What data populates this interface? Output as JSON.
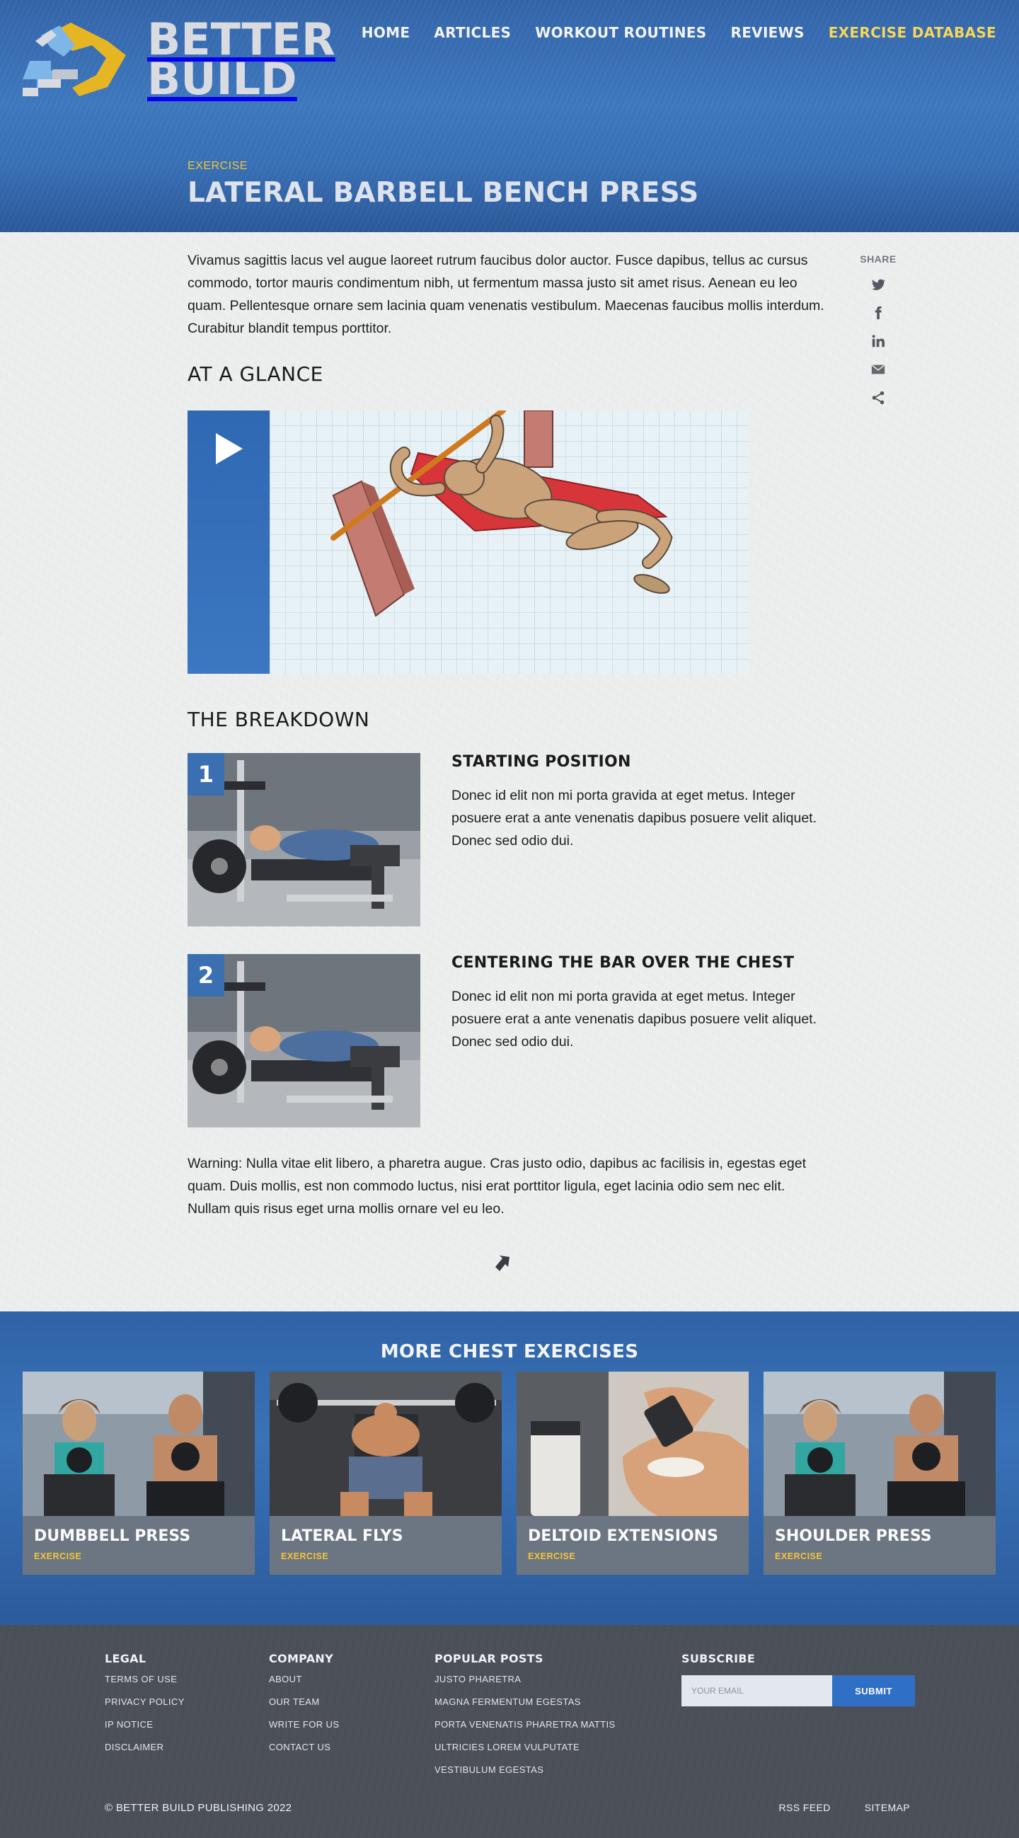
{
  "brand": {
    "name_line1": "BETTER",
    "name_line2": "BUILD",
    "colors": {
      "blue": "#3a72b8",
      "yellow": "#f2c43b",
      "light_blue": "#8fc1ec"
    }
  },
  "nav": {
    "items": [
      "HOME",
      "ARTICLES",
      "WORKOUT ROUTINES",
      "REVIEWS",
      "EXERCISE DATABASE"
    ],
    "active": "EXERCISE DATABASE"
  },
  "hero": {
    "kicker": "EXERCISE",
    "title": "LATERAL BARBELL BENCH PRESS"
  },
  "intro": "Vivamus sagittis lacus vel augue laoreet rutrum faucibus dolor auctor. Fusce dapibus, tellus ac cursus commodo, tortor mauris condimentum nibh, ut fermentum massa justo sit amet risus. Aenean eu leo quam. Pellentesque ornare sem lacinia quam venenatis vestibulum. Maecenas faucibus mollis interdum. Curabitur blandit tempus porttitor.",
  "share": {
    "label": "SHARE",
    "icons": [
      "twitter-icon",
      "facebook-icon",
      "linkedin-icon",
      "email-icon",
      "share-icon"
    ]
  },
  "sections": {
    "glance": "AT A GLANCE",
    "breakdown": "THE BREAKDOWN"
  },
  "steps": [
    {
      "num": "1",
      "title": "STARTING POSITION",
      "text": "Donec id elit non mi porta gravida at eget metus. Integer posuere erat a ante venenatis dapibus posuere velit aliquet. Donec sed odio dui."
    },
    {
      "num": "2",
      "title": "CENTERING THE BAR OVER THE CHEST",
      "text": "Donec id elit non mi porta gravida at eget metus. Integer posuere erat a ante venenatis dapibus posuere velit aliquet. Donec sed odio dui."
    }
  ],
  "warning": "Warning: Nulla vitae elit libero, a pharetra augue. Cras justo odio, dapibus ac facilisis in, egestas eget quam. Duis mollis, est non commodo luctus, nisi erat porttitor ligula, eget lacinia odio sem nec elit. Nullam quis risus eget urna mollis ornare vel eu leo.",
  "more": {
    "title": "MORE CHEST EXERCISES",
    "cards": [
      {
        "title": "DUMBBELL PRESS",
        "tag": "EXERCISE"
      },
      {
        "title": "LATERAL FLYS",
        "tag": "EXERCISE"
      },
      {
        "title": "DELTOID EXTENSIONS",
        "tag": "EXERCISE"
      },
      {
        "title": "SHOULDER PRESS",
        "tag": "EXERCISE"
      }
    ]
  },
  "footer": {
    "legal": {
      "heading": "LEGAL",
      "links": [
        "TERMS OF USE",
        "PRIVACY POLICY",
        "IP NOTICE",
        "DISCLAIMER"
      ]
    },
    "company": {
      "heading": "COMPANY",
      "links": [
        "ABOUT",
        "OUR TEAM",
        "WRITE FOR US",
        "CONTACT US"
      ]
    },
    "popular": {
      "heading": "POPULAR POSTS",
      "links": [
        "JUSTO PHARETRA",
        "MAGNA FERMENTUM EGESTAS",
        "PORTA VENENATIS PHARETRA MATTIS",
        "ULTRICIES LOREM VULPUTATE",
        "VESTIBULUM EGESTAS"
      ]
    },
    "subscribe": {
      "heading": "SUBSCRIBE",
      "placeholder": "YOUR EMAIL",
      "button": "SUBMIT"
    },
    "copyright": "© BETTER BUILD PUBLISHING 2022",
    "links": [
      "RSS FEED",
      "SITEMAP"
    ]
  }
}
